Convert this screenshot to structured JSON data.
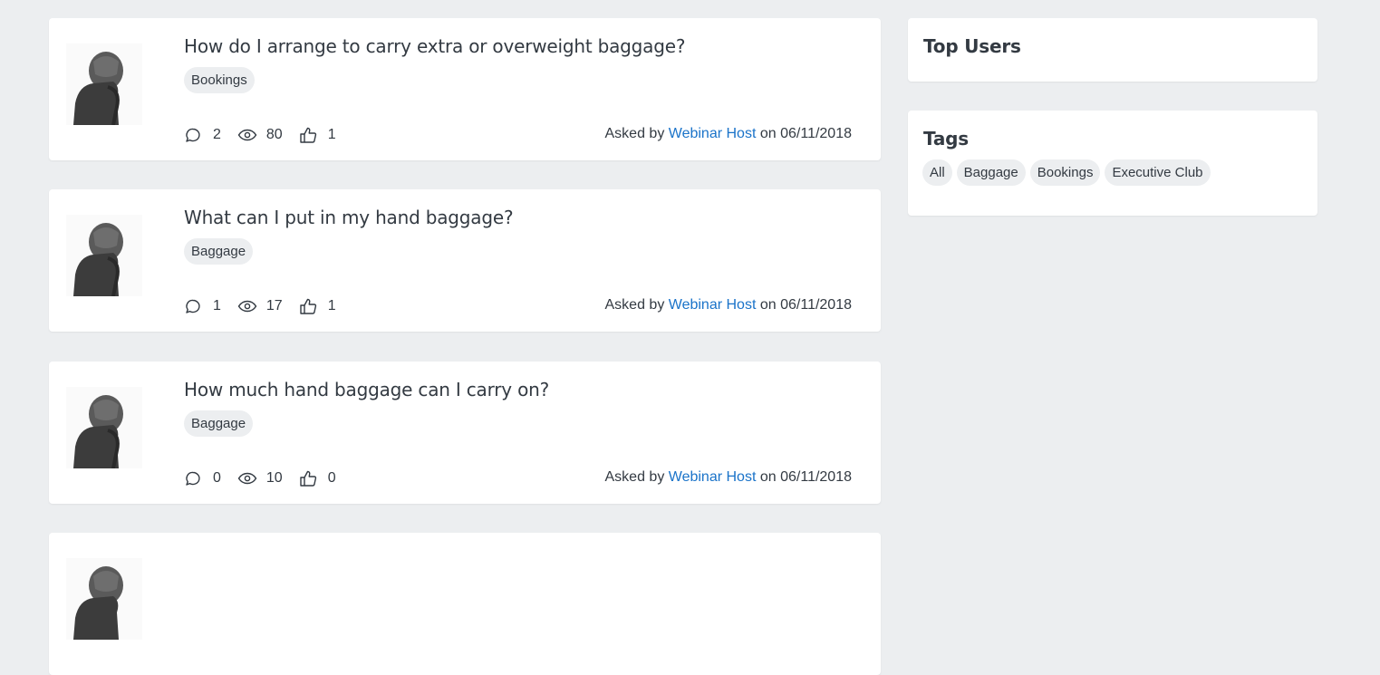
{
  "questions": [
    {
      "title": "How do I arrange to carry extra or overweight baggage?",
      "tag": "Bookings",
      "answers": "2",
      "views": "80",
      "likes": "1",
      "asked_by_prefix": "Asked by",
      "author": "Webinar Host",
      "on_text": "on",
      "date": "06/11/2018"
    },
    {
      "title": "What can I put in my hand baggage?",
      "tag": "Baggage",
      "answers": "1",
      "views": "17",
      "likes": "1",
      "asked_by_prefix": "Asked by",
      "author": "Webinar Host",
      "on_text": "on",
      "date": "06/11/2018"
    },
    {
      "title": "How much hand baggage can I carry on?",
      "tag": "Baggage",
      "answers": "0",
      "views": "10",
      "likes": "0",
      "asked_by_prefix": "Asked by",
      "author": "Webinar Host",
      "on_text": "on",
      "date": "06/11/2018"
    }
  ],
  "sidebar": {
    "top_users_title": "Top Users",
    "tags_title": "Tags",
    "tags": [
      "All",
      "Baggage",
      "Bookings",
      "Executive Club"
    ]
  },
  "icons": {
    "answers": "speech-bubble-icon",
    "views": "eye-icon",
    "likes": "thumbs-up-icon"
  },
  "colors": {
    "link": "#1a73c9",
    "background": "#eceef0",
    "tag_bg": "#eceef0"
  }
}
